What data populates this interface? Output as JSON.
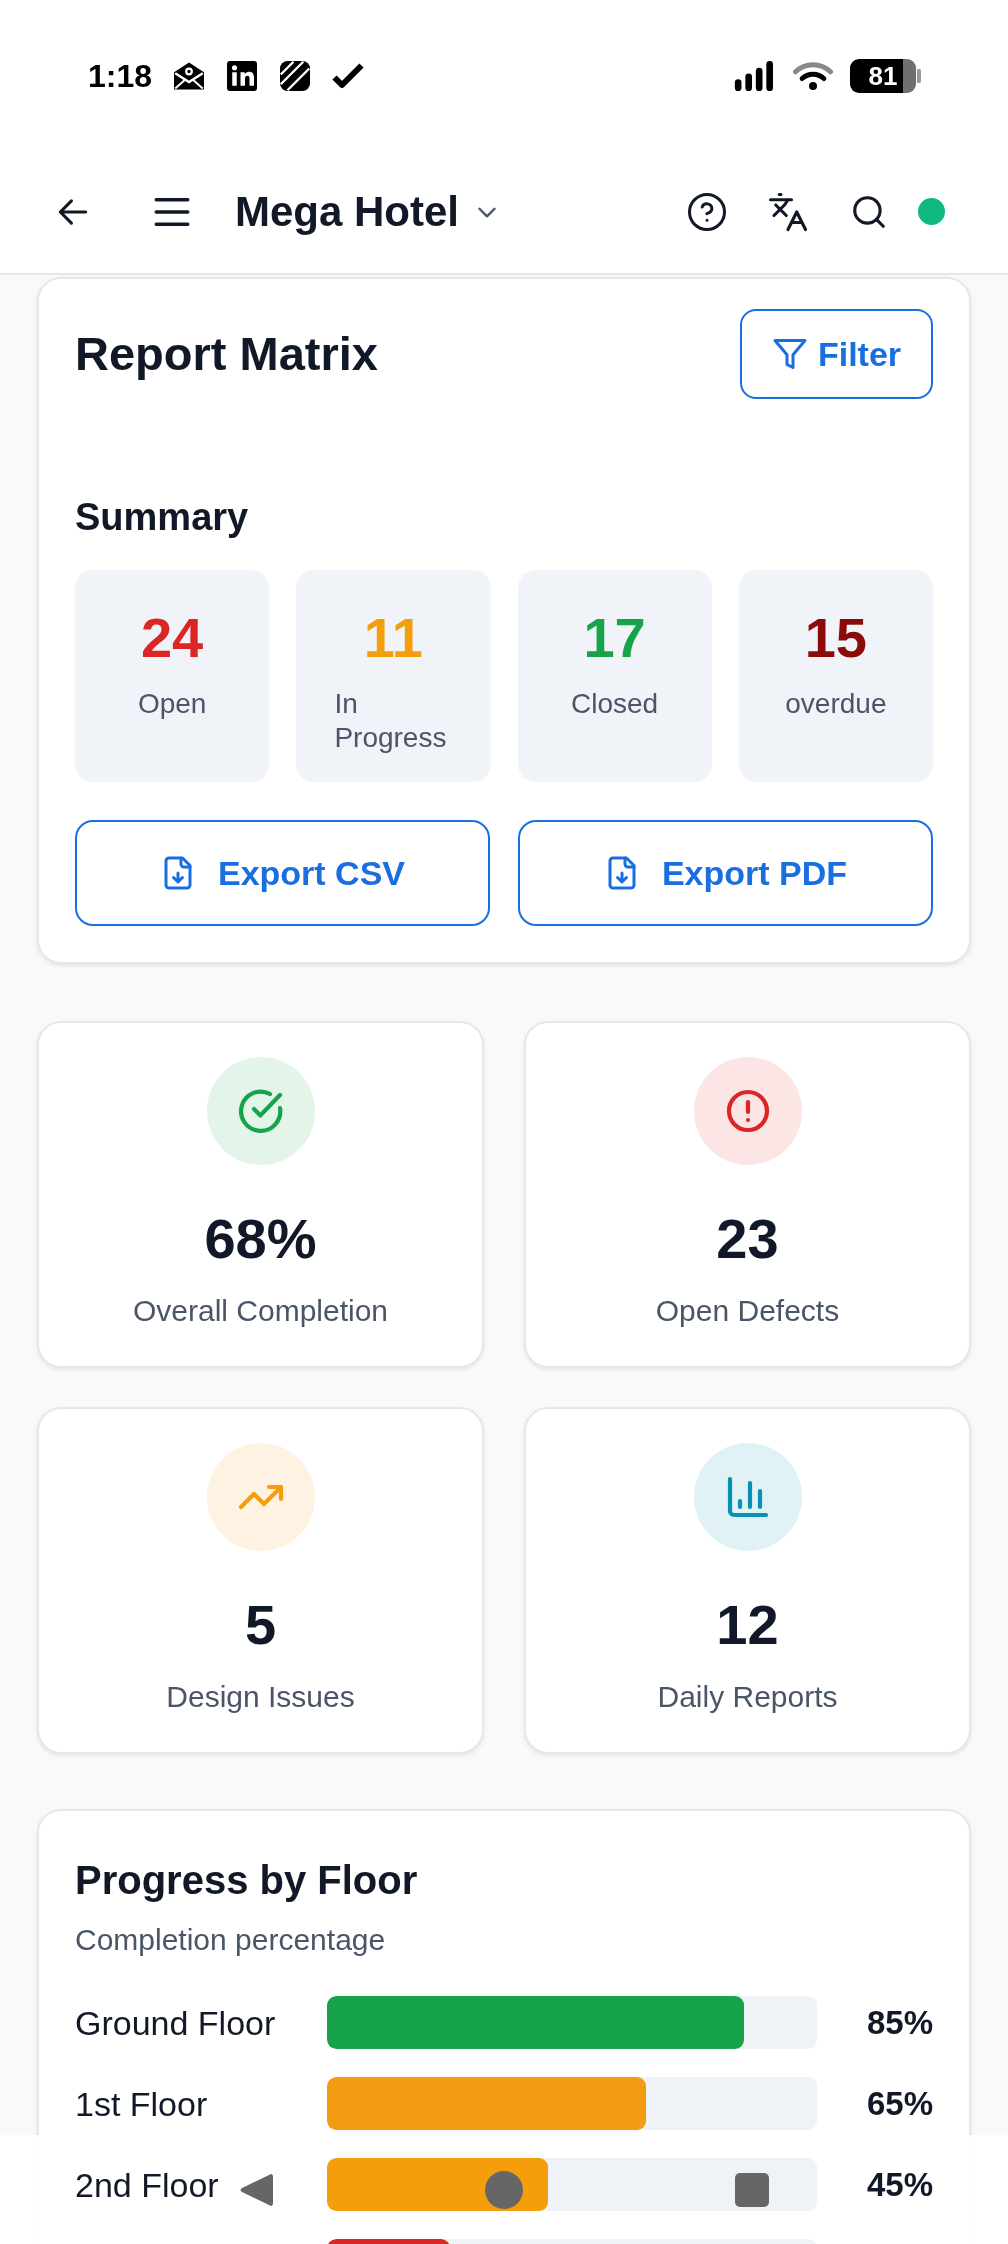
{
  "status_bar": {
    "time": "1:18",
    "battery": "81"
  },
  "header": {
    "title": "Mega Hotel"
  },
  "report_card": {
    "title": "Report Matrix",
    "filter_button": "Filter",
    "summary_title": "Summary",
    "summary": [
      {
        "value": "24",
        "label": "Open",
        "color": "#dc2626"
      },
      {
        "value": "11",
        "label": "In Progress",
        "color": "#f59e0b"
      },
      {
        "value": "17",
        "label": "Closed",
        "color": "#16a34a"
      },
      {
        "value": "15",
        "label": "overdue",
        "color": "#8b0b0b"
      }
    ],
    "export_buttons": [
      "Export CSV",
      "Export PDF"
    ]
  },
  "stats": [
    {
      "kind": "check",
      "value": "68%",
      "label": "Overall Completion",
      "color": "#16a34a"
    },
    {
      "kind": "alert",
      "value": "23",
      "label": "Open Defects",
      "color": "#dc2626"
    },
    {
      "kind": "trend",
      "value": "5",
      "label": "Design Issues",
      "color": "#f59e0b"
    },
    {
      "kind": "chart",
      "value": "12",
      "label": "Daily Reports",
      "color": "#0891b2"
    }
  ],
  "progress": {
    "title": "Progress by Floor",
    "subtitle": "Completion percentage",
    "floors": [
      {
        "label": "Ground Floor",
        "level": 0.85,
        "reading": "85%",
        "color": "#16a34a"
      },
      {
        "label": "1st Floor",
        "level": 0.65,
        "reading": "65%",
        "color": "#f39c12"
      },
      {
        "label": "2nd Floor",
        "level": 0.45,
        "reading": "45%",
        "color": "#f59e0b"
      },
      {
        "level": 0.25,
        "color": "#dc2626"
      }
    ]
  }
}
